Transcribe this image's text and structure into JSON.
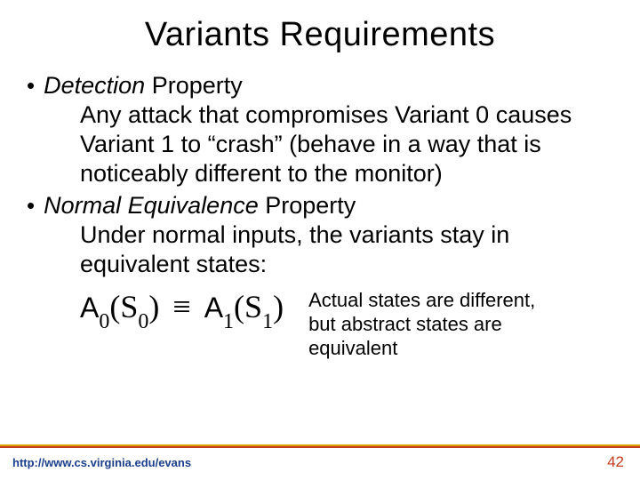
{
  "title": "Variants Requirements",
  "bullet1": {
    "term": "Detection",
    "rest": " Property"
  },
  "body1": "Any attack that compromises Variant 0 causes Variant 1 to “crash” (behave in a way that is noticeably different to the monitor)",
  "bullet2": {
    "term": "Normal Equivalence",
    "rest": " Property"
  },
  "body2": "Under normal inputs, the variants stay in equivalent states:",
  "formula": {
    "A": "A",
    "sub0a": "0",
    "open": "(",
    "S": "S",
    "sub0b": "0",
    "close": ")",
    "equiv": "≡",
    "A2": "A",
    "sub1a": "1",
    "open2": "(",
    "S2": "S",
    "sub1b": "1",
    "close2": ")"
  },
  "note": "Actual states are different, but abstract states are equivalent",
  "footer": {
    "url": "http://www.cs.virginia.edu/evans",
    "page": "42"
  }
}
